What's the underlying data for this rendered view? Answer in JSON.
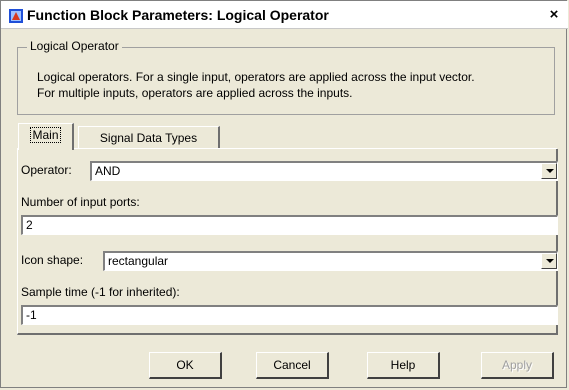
{
  "window": {
    "title": "Function Block Parameters: Logical Operator",
    "close_label": "×"
  },
  "group": {
    "legend": "Logical Operator",
    "description_line1": "Logical operators.  For a single input, operators are applied across the input vector.",
    "description_line2": "For multiple inputs, operators are applied across the inputs."
  },
  "tabs": [
    {
      "label": "Main"
    },
    {
      "label": "Signal Data Types"
    }
  ],
  "params": {
    "operator_label": "Operator:",
    "operator_value": "AND",
    "num_ports_label": "Number of input ports:",
    "num_ports_value": "2",
    "icon_shape_label": "Icon shape:",
    "icon_shape_value": "rectangular",
    "sample_time_label": "Sample time (-1 for inherited):",
    "sample_time_value": "-1"
  },
  "buttons": {
    "ok": "OK",
    "cancel": "Cancel",
    "help": "Help",
    "apply": "Apply"
  },
  "colors": {
    "dialog_bg": "#ece9d8",
    "title_icon_blue": "#1f4fd8",
    "title_icon_red": "#d83a1f"
  }
}
